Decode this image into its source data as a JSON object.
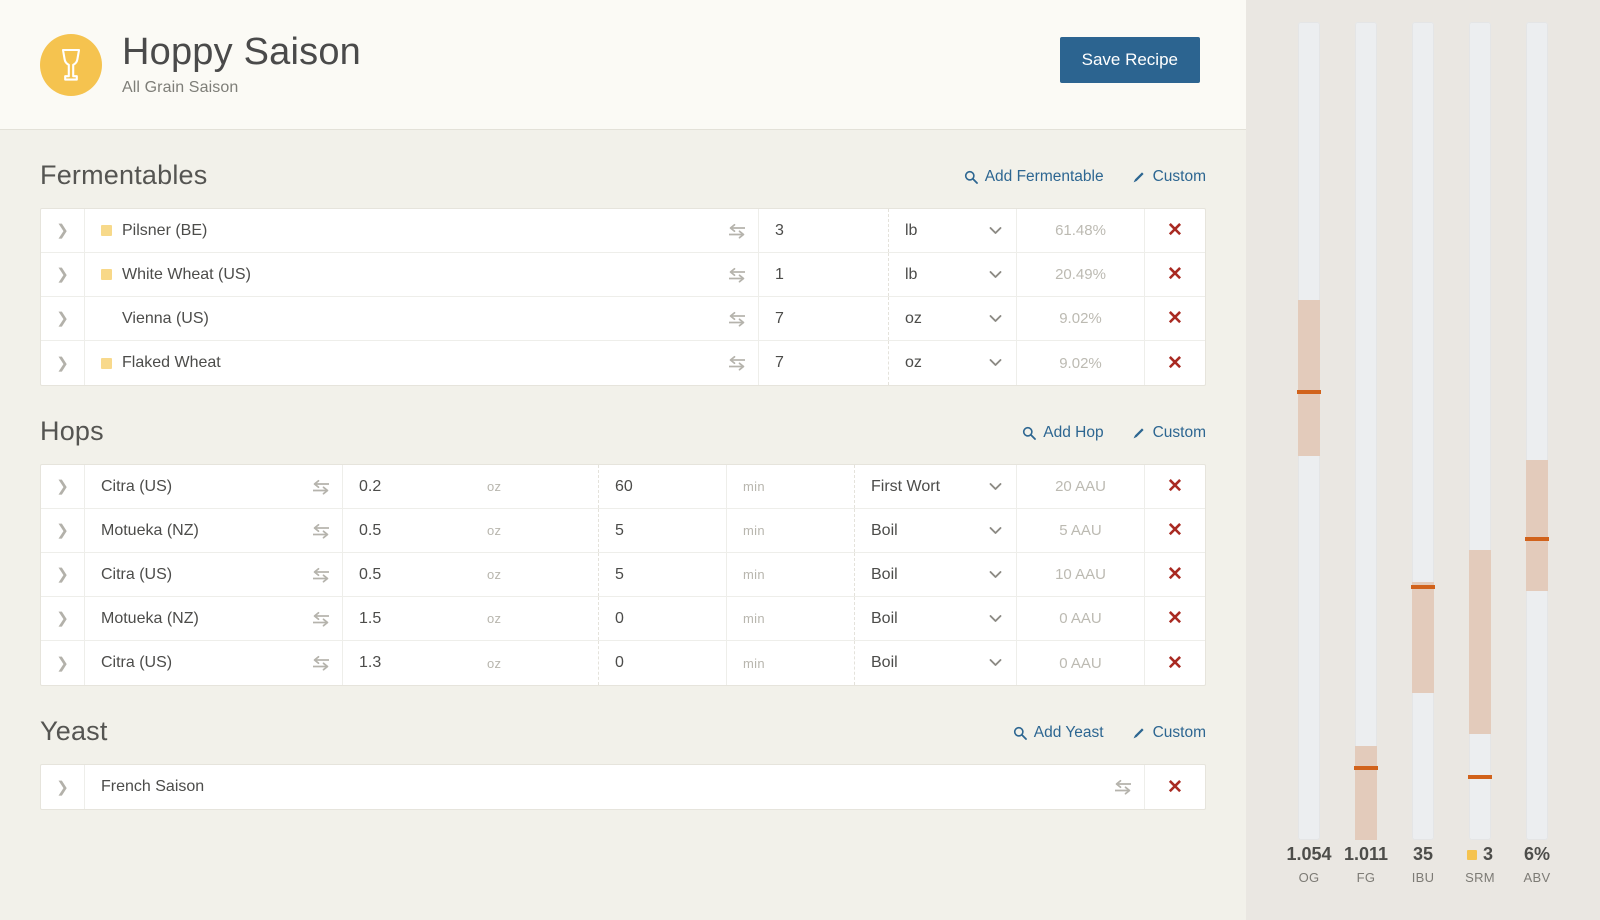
{
  "header": {
    "badge_icon": "beer-glass-icon",
    "badge_color": "#f5c34f",
    "title": "Hoppy Saison",
    "subtitle": "All Grain Saison",
    "save_label": "Save Recipe",
    "save_color": "#2c6490"
  },
  "sections": [
    {
      "key": "fermentables",
      "title": "Fermentables",
      "add_label": "Add Fermentable",
      "custom_label": "Custom"
    },
    {
      "key": "hops",
      "title": "Hops",
      "add_label": "Add Hop",
      "custom_label": "Custom"
    },
    {
      "key": "yeast",
      "title": "Yeast",
      "add_label": "Add Yeast",
      "custom_label": "Custom"
    }
  ],
  "fermentables": [
    {
      "name": "Pilsner (BE)",
      "swatch": "#f7d98a",
      "amount": "3",
      "unit": "lb",
      "percent": "61.48%"
    },
    {
      "name": "White Wheat  (US)",
      "swatch": "#f8d888",
      "amount": "1",
      "unit": "lb",
      "percent": "20.49%"
    },
    {
      "name": "Vienna (US)",
      "swatch": "#f5b battle",
      "amount": "7",
      "unit": "oz",
      "percent": "9.02%"
    },
    {
      "name": "Flaked Wheat",
      "swatch": "#f8d98c",
      "amount": "7",
      "unit": "oz",
      "percent": "9.02%"
    }
  ],
  "hops": [
    {
      "name": "Citra (US)",
      "amount": "0.2",
      "unit": "oz",
      "time": "60",
      "time_unit": "min",
      "use": "First Wort",
      "aau": "20 AAU"
    },
    {
      "name": "Motueka (NZ)",
      "amount": "0.5",
      "unit": "oz",
      "time": "5",
      "time_unit": "min",
      "use": "Boil",
      "aau": "5 AAU"
    },
    {
      "name": "Citra (US)",
      "amount": "0.5",
      "unit": "oz",
      "time": "5",
      "time_unit": "min",
      "use": "Boil",
      "aau": "10 AAU"
    },
    {
      "name": "Motueka (NZ)",
      "amount": "1.5",
      "unit": "oz",
      "time": "0",
      "time_unit": "min",
      "use": "Boil",
      "aau": "0 AAU"
    },
    {
      "name": "Citra (US)",
      "amount": "1.3",
      "unit": "oz",
      "time": "0",
      "time_unit": "min",
      "use": "Boil",
      "aau": "0 AAU"
    }
  ],
  "yeast": [
    {
      "name": "French Saison"
    }
  ],
  "chart_data": {
    "type": "bar",
    "title": "Recipe stats gauges",
    "orientation": "vertical",
    "band_color": "#e3cbbb",
    "marker_color": "#d1621b",
    "track_color": "#eceef0",
    "gauges": [
      {
        "label": "OG",
        "value": "1.054",
        "band_top_pct": 34.0,
        "band_bottom_pct": 53.0,
        "marker_pct": 45.0,
        "swatch": null
      },
      {
        "label": "FG",
        "value": "1.011",
        "band_top_pct": 88.5,
        "band_bottom_pct": 100.0,
        "marker_pct": 91.0,
        "swatch": null
      },
      {
        "label": "IBU",
        "value": "35",
        "band_top_pct": 68.5,
        "band_bottom_pct": 82.0,
        "marker_pct": 68.8,
        "swatch": null
      },
      {
        "label": "SRM",
        "value": "3",
        "band_top_pct": 64.5,
        "band_bottom_pct": 87.0,
        "marker_pct": 92.0,
        "swatch": "#f5c34f"
      },
      {
        "label": "ABV",
        "value": "6%",
        "band_top_pct": 53.5,
        "band_bottom_pct": 69.5,
        "marker_pct": 63.0,
        "swatch": null
      }
    ]
  }
}
